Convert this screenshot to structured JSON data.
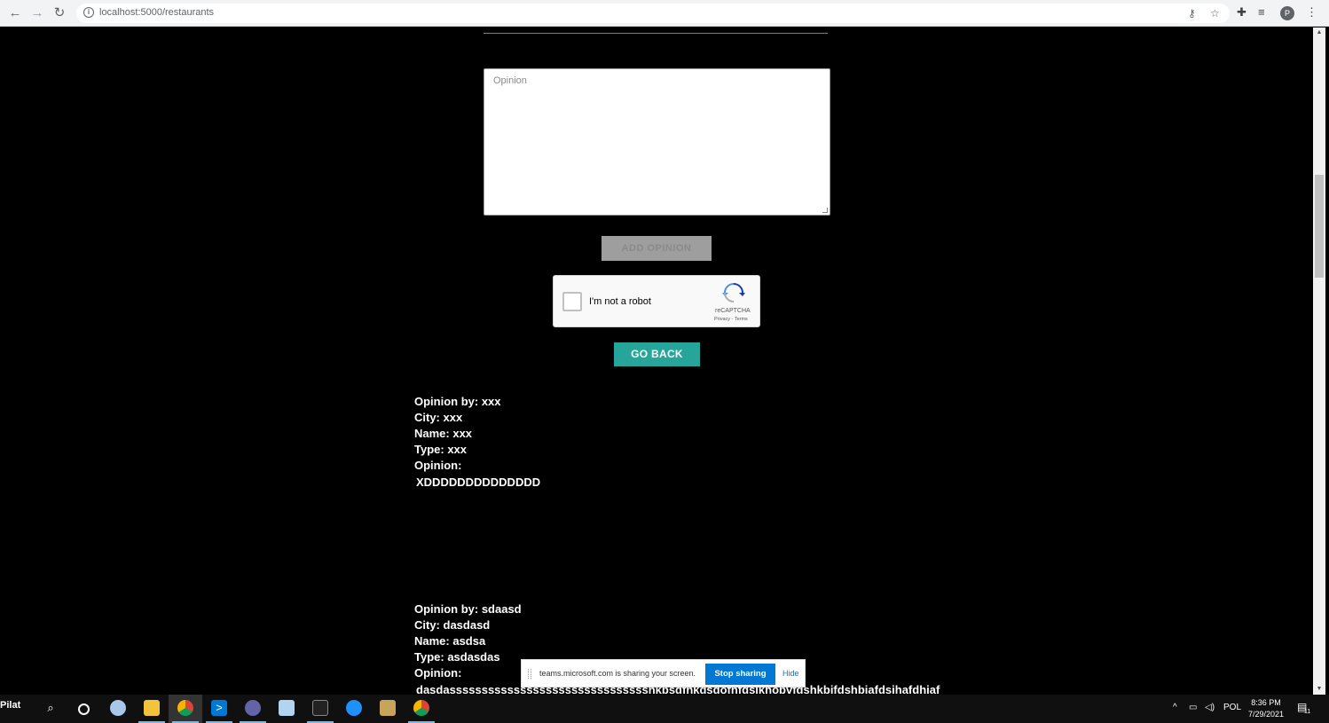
{
  "browser": {
    "url": "localhost:5000/restaurants"
  },
  "form": {
    "opinion_placeholder": "Opinion",
    "add_button": "ADD OPINION",
    "recaptcha_label": "I'm not a robot",
    "recaptcha_brand": "reCAPTCHA",
    "recaptcha_terms": "Privacy - Terms",
    "go_back": "GO BACK"
  },
  "opinions": [
    {
      "by": "Opinion by: xxx",
      "city": "City: xxx",
      "name": "Name: xxx",
      "type": "Type: xxx",
      "opinion_label": "Opinion:",
      "text": "XDDDDDDDDDDDDDD"
    },
    {
      "by": "Opinion by: sdaasd",
      "city": "City: dasdasd",
      "name": "Name: asdsa",
      "type": "Type: asdasdas",
      "opinion_label": "Opinion:",
      "text": "dasdassssssssssssssssssssssssssssssshkbsdfhkdsdofhfdsikhobvfdshkbifdshbiafdsihafdhiaf"
    }
  ],
  "share_bar": {
    "message": "teams.microsoft.com is sharing your screen.",
    "stop": "Stop sharing",
    "hide": "Hide"
  },
  "taskbar": {
    "start_label": "Pilat",
    "language": "POL",
    "time": "8:36 PM",
    "date": "7/29/2021",
    "notifications": "11"
  }
}
